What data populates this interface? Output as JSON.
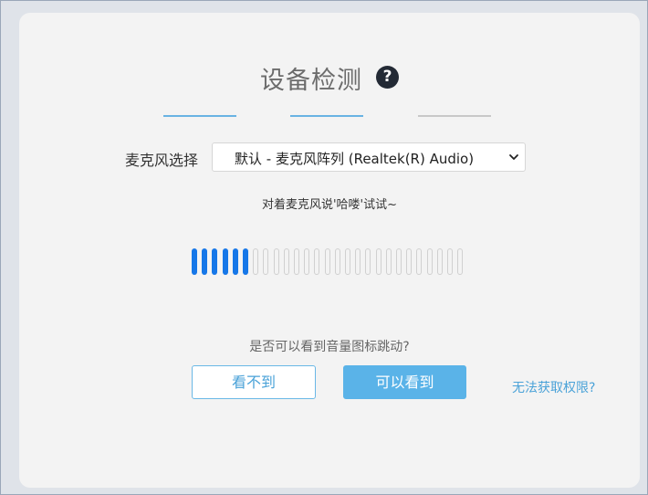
{
  "dialog": {
    "title": "设备检测",
    "help_icon": "question-circle-icon",
    "steps": [
      {
        "state": "complete"
      },
      {
        "state": "complete"
      },
      {
        "state": "pending"
      }
    ],
    "step_colors": {
      "complete": "#69b3e3",
      "pending": "#c8c8c8"
    }
  },
  "microphone": {
    "label": "麦克风选择",
    "selected": "默认 - 麦克风阵列 (Realtek(R) Audio)"
  },
  "hint": "对着麦克风说'哈喽'试试~",
  "meter": {
    "total_bars": 27,
    "active_bars": 6,
    "active_color": "#1677e8"
  },
  "question": "是否可以看到音量图标跳动?",
  "buttons": {
    "no_label": "看不到",
    "yes_label": "可以看到",
    "accent": "#5ab3e8"
  },
  "permission_link": "无法获取权限?"
}
